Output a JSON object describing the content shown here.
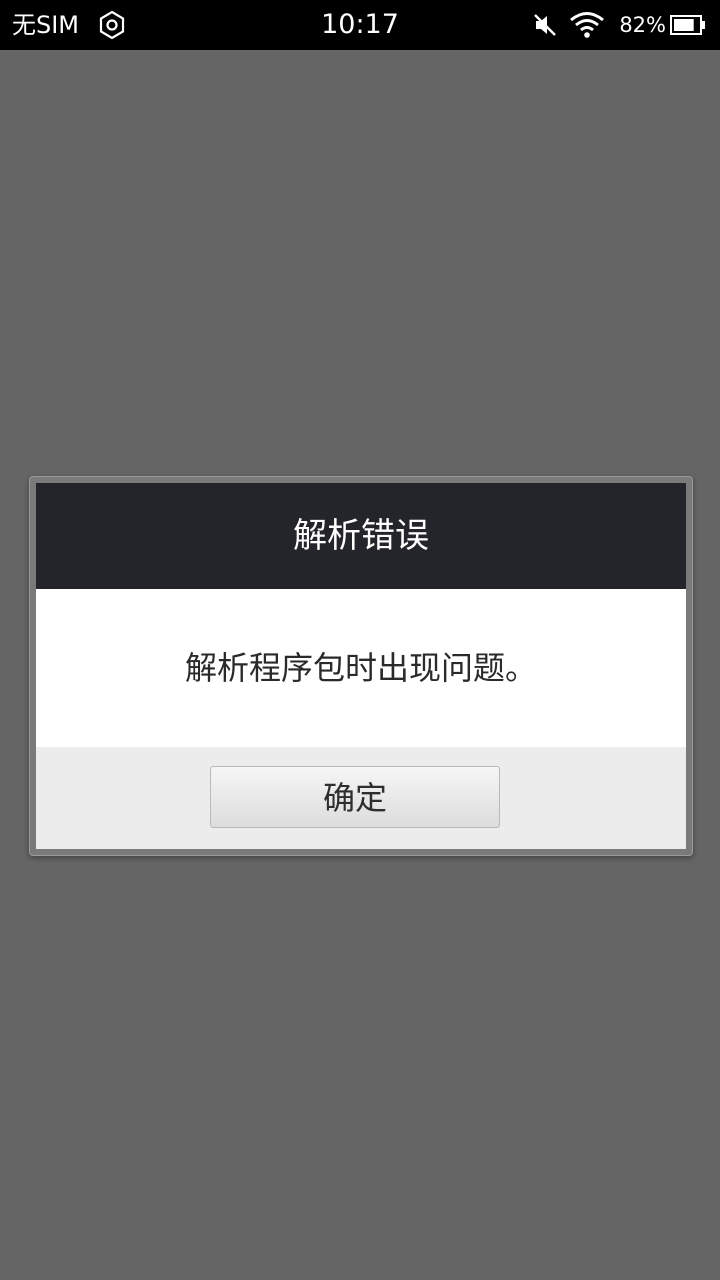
{
  "status_bar": {
    "carrier": "无SIM",
    "settings_icon": "hexagon-settings-icon",
    "time": "10:17",
    "mute_icon": "mute-icon",
    "wifi_icon": "wifi-icon",
    "battery_percent": "82%",
    "battery_icon": "battery-icon",
    "battery_level": 0.82
  },
  "dialog": {
    "title": "解析错误",
    "message": "解析程序包时出现问题。",
    "ok_label": "确定"
  },
  "colors": {
    "status_bar_bg": "#000000",
    "screen_bg": "#656565",
    "dialog_header_bg": "#24252a",
    "dialog_body_bg": "#ffffff",
    "dialog_footer_bg": "#ececec"
  }
}
